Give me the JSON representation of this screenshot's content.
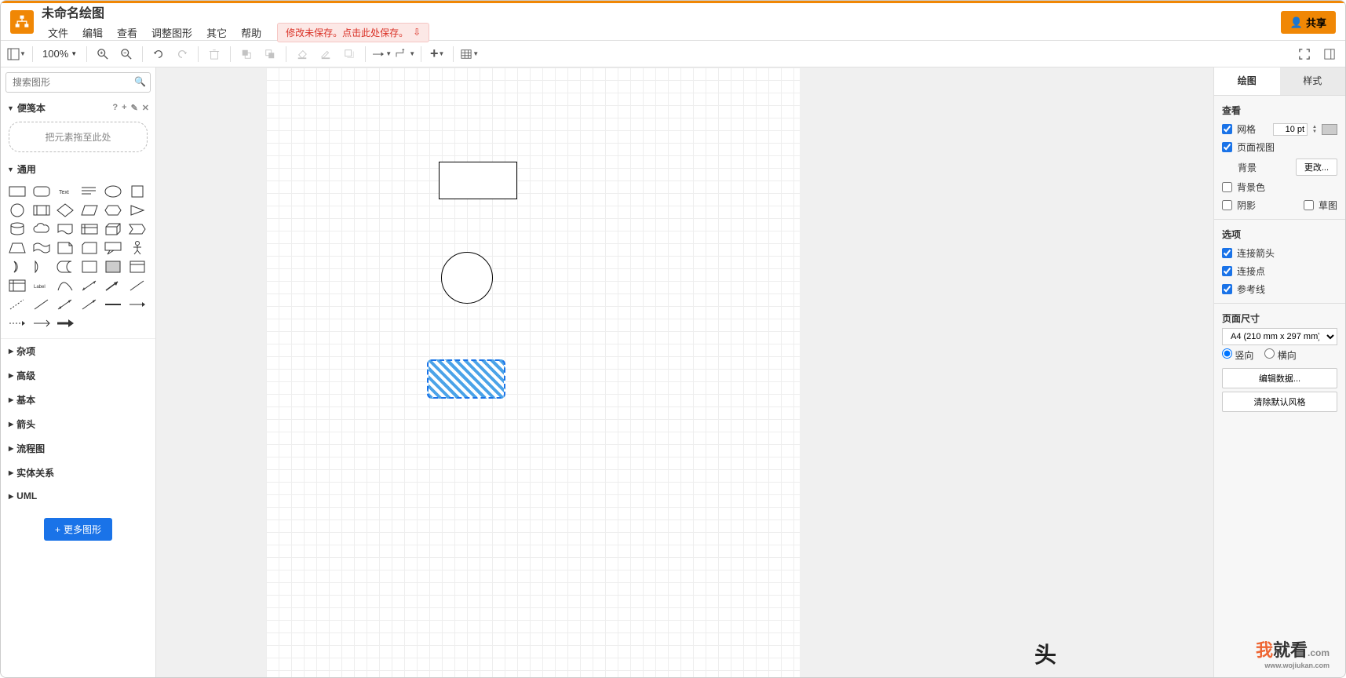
{
  "header": {
    "doc_title": "未命名绘图",
    "menus": [
      "文件",
      "编辑",
      "查看",
      "调整图形",
      "其它",
      "帮助"
    ],
    "save_warning": "修改未保存。点击此处保存。",
    "share_label": "共享"
  },
  "toolbar": {
    "zoom": "100%"
  },
  "left": {
    "search_placeholder": "搜索图形",
    "scratchpad_title": "便笺本",
    "scratch_drop": "把元素拖至此处",
    "general_title": "通用",
    "categories": [
      "杂项",
      "高级",
      "基本",
      "箭头",
      "流程图",
      "实体关系",
      "UML"
    ],
    "more_shapes": "更多图形"
  },
  "right": {
    "tabs": [
      "绘图",
      "样式"
    ],
    "view_title": "查看",
    "grid_label": "网格",
    "grid_size": "10 pt",
    "page_view": "页面视图",
    "background_label": "背景",
    "change_btn": "更改...",
    "bgcolor_label": "背景色",
    "shadow_label": "阴影",
    "sketch_label": "草图",
    "options_title": "选项",
    "conn_arrows": "连接箭头",
    "conn_points": "连接点",
    "guides": "参考线",
    "page_size_title": "页面尺寸",
    "page_size_value": "A4 (210 mm x 297 mm)",
    "portrait": "竖向",
    "landscape": "横向",
    "edit_data": "编辑数据...",
    "clear_style": "清除默认风格"
  },
  "watermark": {
    "text1": "我",
    "text2": "就看",
    "domain": "www.wojiukan.com"
  }
}
